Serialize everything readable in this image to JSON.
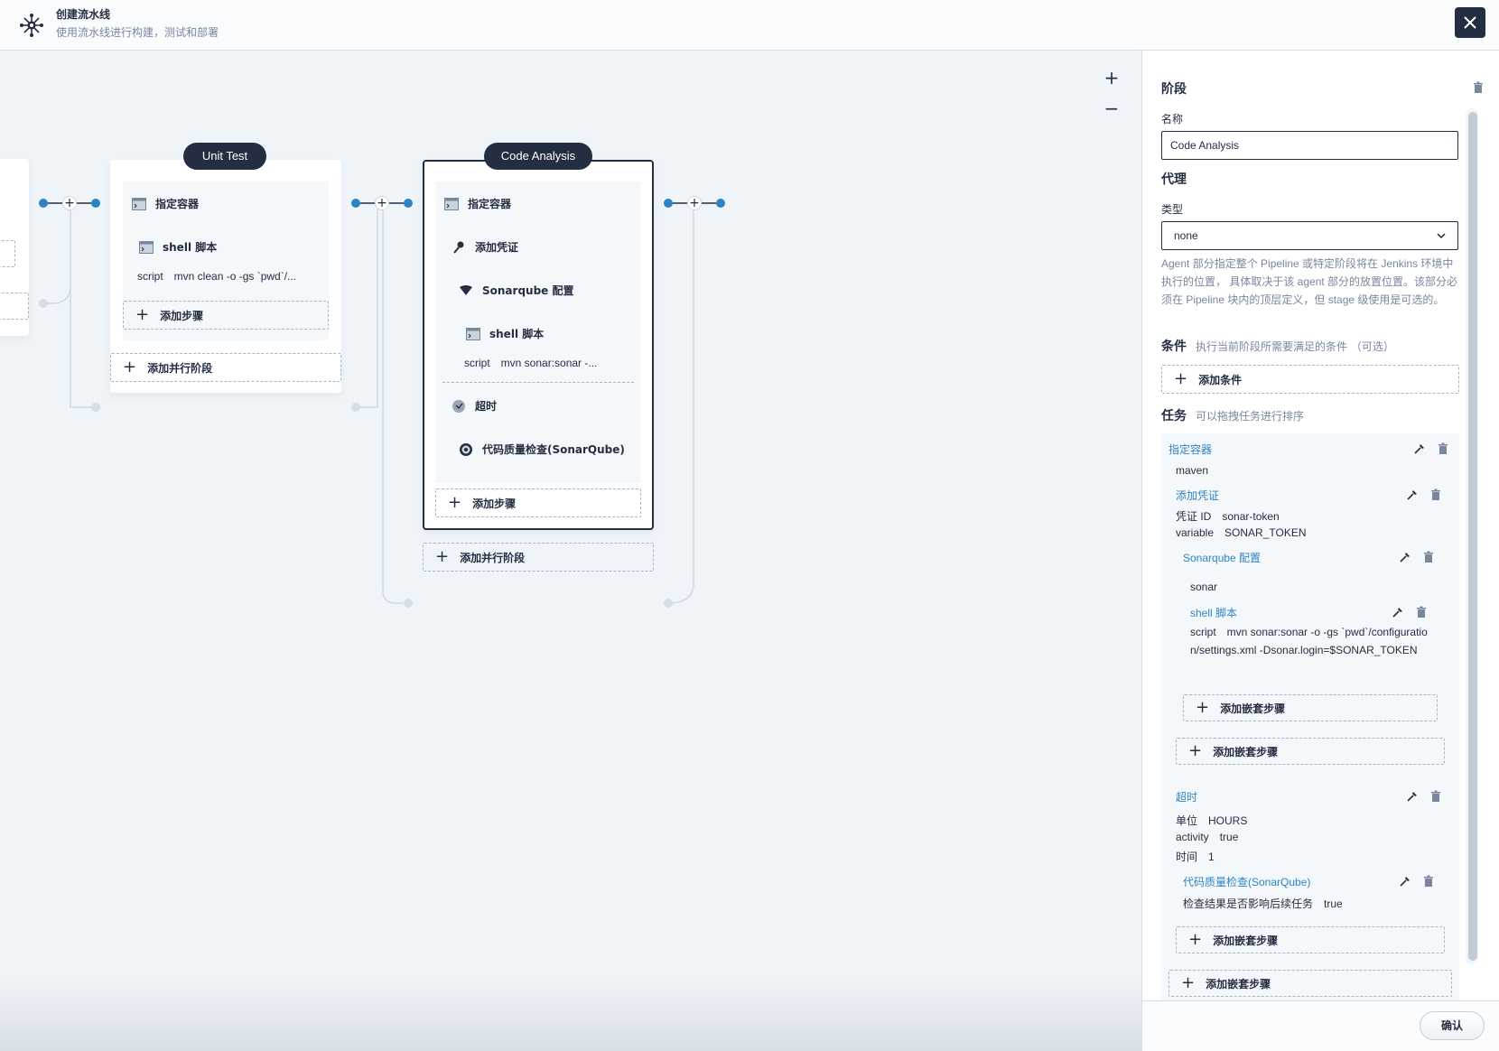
{
  "header": {
    "title": "创建流水线",
    "subtitle": "使用流水线进行构建，测试和部署"
  },
  "canvas": {
    "zoom_in": "+",
    "zoom_out": "−",
    "stages": [
      {
        "name": "Unit Test",
        "steps": [
          {
            "label": "指定容器"
          },
          {
            "label": "shell 脚本",
            "detail_key": "script",
            "detail_value": "mvn clean -o -gs `pwd`/..."
          }
        ],
        "add_step": "添加步骤",
        "add_parallel": "添加并行阶段"
      },
      {
        "name": "Code Analysis",
        "steps": [
          {
            "label": "指定容器"
          },
          {
            "label": "添加凭证"
          },
          {
            "label": "Sonarqube 配置"
          },
          {
            "label": "shell 脚本",
            "detail_key": "script",
            "detail_value": "mvn sonar:sonar -..."
          },
          {
            "label": "超时"
          },
          {
            "label": "代码质量检查(SonarQube)"
          }
        ],
        "add_step": "添加步骤",
        "add_parallel": "添加并行阶段"
      }
    ]
  },
  "panel": {
    "section_stage": "阶段",
    "name_label": "名称",
    "name_value": "Code Analysis",
    "section_agent": "代理",
    "type_label": "类型",
    "type_value": "none",
    "agent_desc": "Agent 部分指定整个 Pipeline 或特定阶段将在 Jenkins 环境中执行的位置， 具体取决于该 agent 部分的放置位置。该部分必须在 Pipeline 块内的顶层定义，但 stage 级使用是可选的。",
    "section_condition": "条件",
    "condition_hint": "执行当前阶段所需要满足的条件 （可选）",
    "add_condition": "添加条件",
    "section_tasks": "任务",
    "tasks_hint": "可以拖拽任务进行排序",
    "tasks": {
      "container_title": "指定容器",
      "container_value": "maven",
      "cred_title": "添加凭证",
      "cred_id_key": "凭证 ID",
      "cred_id_val": "sonar-token",
      "cred_var_key": "variable",
      "cred_var_val": "SONAR_TOKEN",
      "sonar_title": "Sonarqube 配置",
      "sonar_value": "sonar",
      "shell_title": "shell 脚本",
      "shell_key": "script",
      "shell_val": "mvn sonar:sonar -o -gs `pwd`/configuration/settings.xml -Dsonar.login=$SONAR_TOKEN",
      "add_nested": "添加嵌套步骤",
      "timeout_title": "超时",
      "unit_key": "单位",
      "unit_val": "HOURS",
      "activity_key": "activity",
      "activity_val": "true",
      "time_key": "时间",
      "time_val": "1",
      "qg_title": "代码质量检查(SonarQube)",
      "qg_key": "检查结果是否影响后续任务",
      "qg_val": "true"
    },
    "confirm": "确认"
  },
  "colors": {
    "dark": "#242e42",
    "accent": "#2c84c4",
    "muted": "#79879c",
    "canvas_bg": "#eff4f8"
  },
  "icons": [
    "pipeline-logo-icon",
    "close-icon",
    "terminal-icon",
    "key-icon",
    "sonarqube-icon",
    "clock-icon",
    "quality-gate-icon",
    "edit-icon",
    "trash-icon",
    "chevron-down-icon",
    "plus-icon"
  ]
}
